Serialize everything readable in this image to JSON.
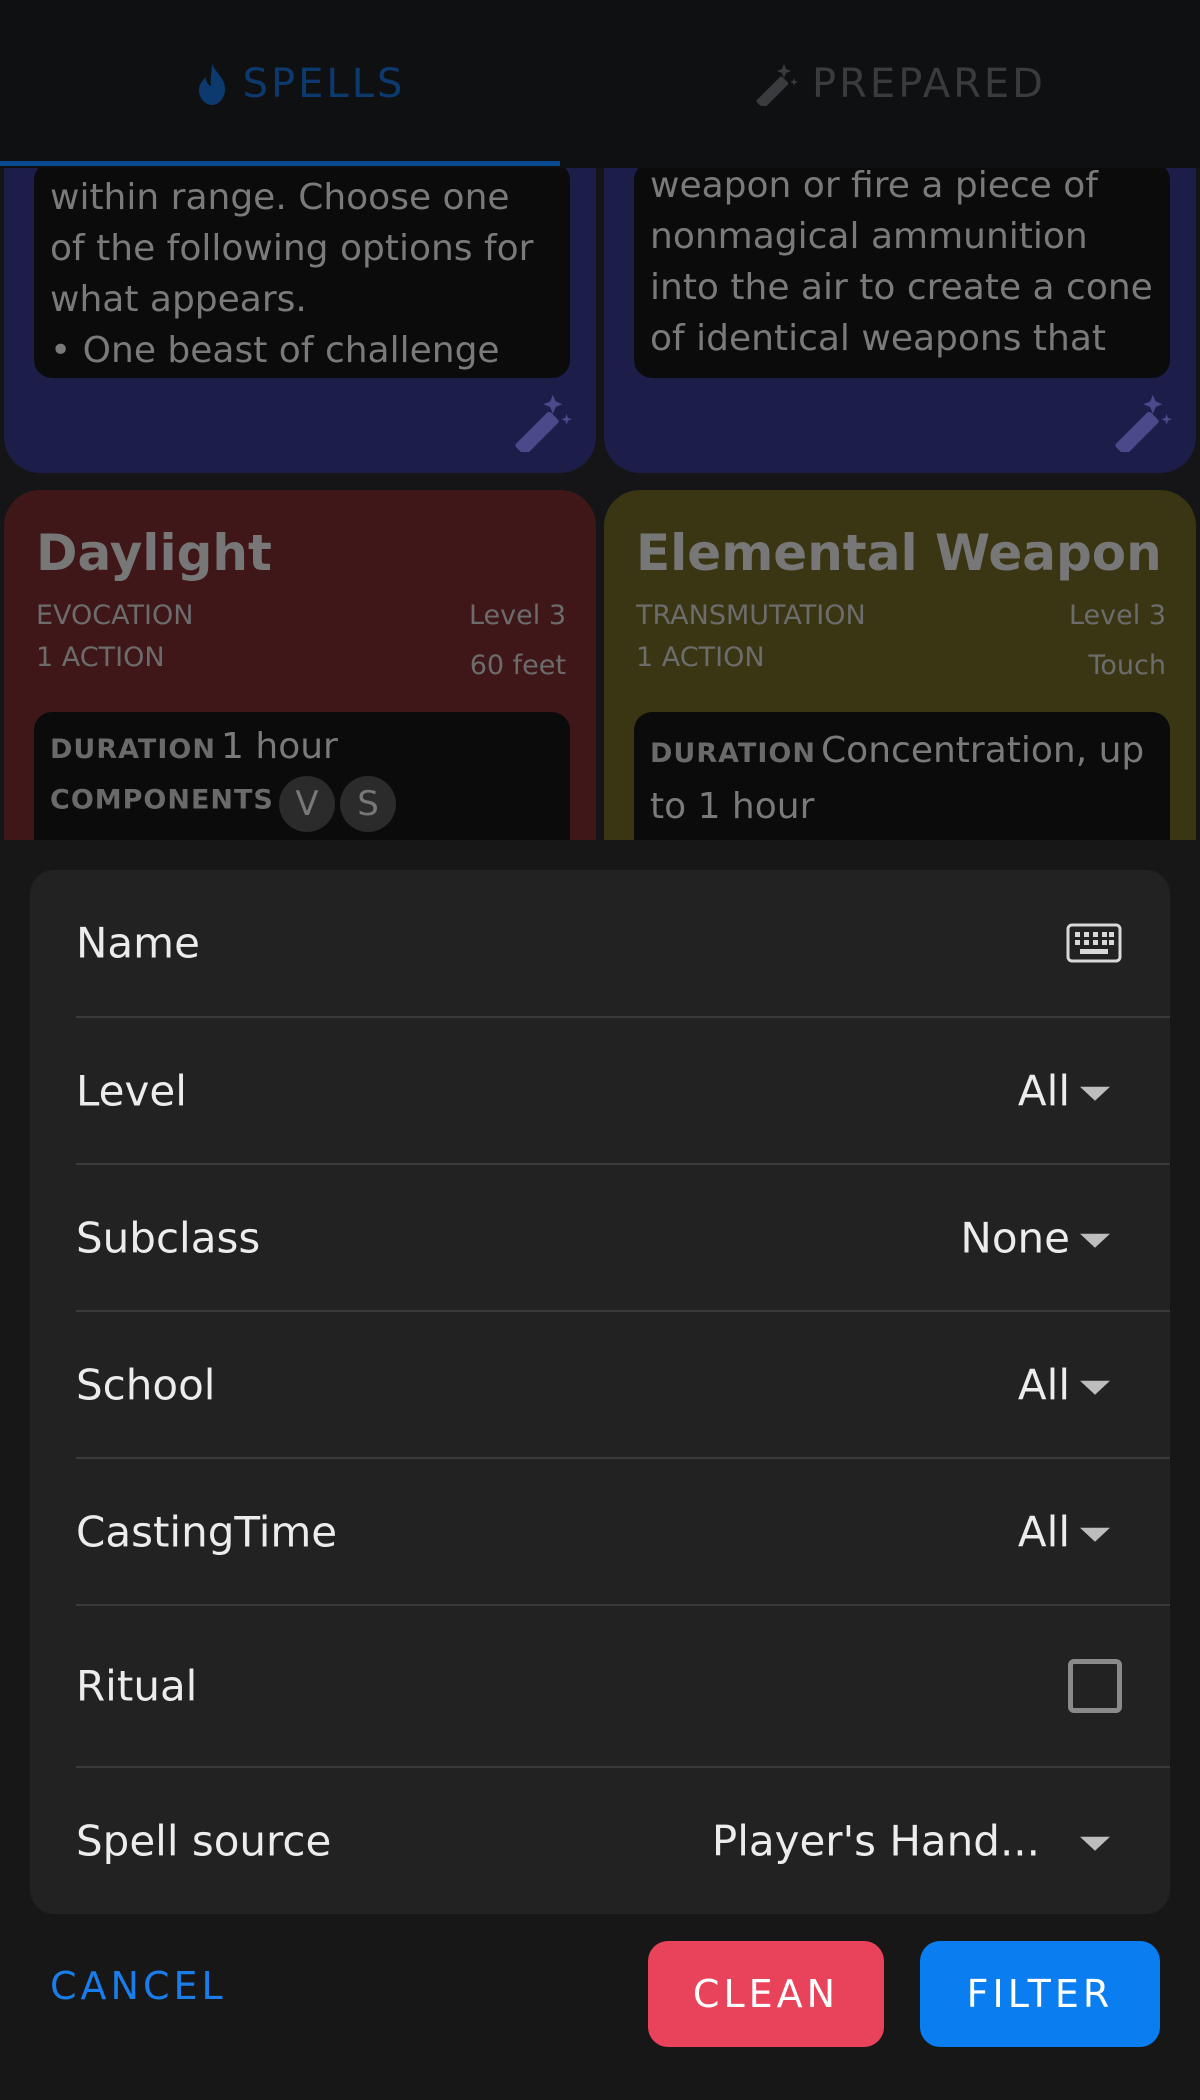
{
  "tabs": {
    "spells": "SPELLS",
    "prepared": "PREPARED"
  },
  "cards": {
    "top_left": {
      "description": "within range. Choose one of the following options for what appears.\n• One beast of challenge"
    },
    "top_right": {
      "description": "weapon or fire a piece of nonmagical ammunition into the air to create a cone of identical weapons that"
    },
    "daylight": {
      "title": "Daylight",
      "school": "EVOCATION",
      "level": "Level 3",
      "casting_time": "1 ACTION",
      "range": "60 feet",
      "duration_label": "DURATION",
      "duration": "1 hour",
      "components_label": "COMPONENTS",
      "components": [
        "V",
        "S"
      ]
    },
    "elemental_weapon": {
      "title": "Elemental Weapon",
      "school": "TRANSMUTATION",
      "level": "Level 3",
      "casting_time": "1 ACTION",
      "range": "Touch",
      "duration_label": "DURATION",
      "duration": "Concentration, up to 1 hour"
    }
  },
  "filter": {
    "name_label": "Name",
    "level_label": "Level",
    "level_value": "All",
    "subclass_label": "Subclass",
    "subclass_value": "None",
    "school_label": "School",
    "school_value": "All",
    "casting_time_label": "CastingTime",
    "casting_time_value": "All",
    "ritual_label": "Ritual",
    "ritual_checked": false,
    "source_label": "Spell source",
    "source_value": "Player's Hand..."
  },
  "actions": {
    "cancel": "CANCEL",
    "clean": "CLEAN",
    "filter": "FILTER"
  },
  "colors": {
    "accent_blue": "#0a7ef0",
    "clean_red": "#e8435a",
    "card_purple": "#1d1d4a",
    "card_red": "#401718",
    "card_olive": "#3a3613"
  },
  "icons": {
    "spells_tab": "flame-icon",
    "prepared_tab": "magic-wand-icon",
    "name_field": "keyboard-icon",
    "card_action": "magic-wand-icon"
  }
}
